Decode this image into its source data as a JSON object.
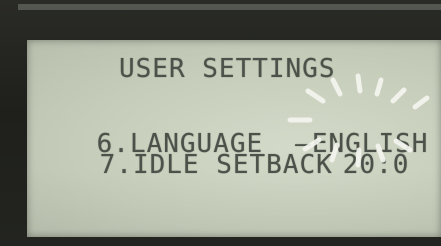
{
  "display": {
    "title": "USER SETTINGS",
    "rows": [
      {
        "number": "6.",
        "label": "LANGUAGE",
        "value": "ENGLISH",
        "marker": "—"
      },
      {
        "number": "7.",
        "label": "IDLE SETBACK",
        "value": "20:0"
      }
    ]
  },
  "colors": {
    "bezel": "#23241f",
    "lcd_background": "#c6cdba",
    "lcd_text": "#4c5249",
    "blink_rays": "#f4f5ef"
  }
}
